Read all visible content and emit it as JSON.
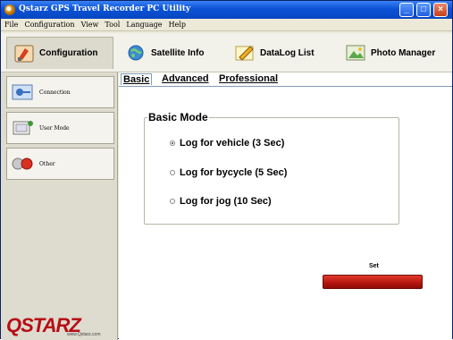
{
  "window": {
    "title": "Qstarz GPS Travel Recorder PC Utility",
    "minimize_glyph": "_",
    "maximize_glyph": "□",
    "close_glyph": "×"
  },
  "menu": [
    "File",
    "Configuration",
    "View",
    "Tool",
    "Language",
    "Help"
  ],
  "top_tabs": [
    {
      "label": "Configuration",
      "icon": "configuration-icon",
      "active": true
    },
    {
      "label": "Satellite Info",
      "icon": "satellite-globe-icon",
      "active": false
    },
    {
      "label": "DataLog List",
      "icon": "datalog-pencil-icon",
      "active": false
    },
    {
      "label": "Photo Manager",
      "icon": "photo-manager-icon",
      "active": false
    }
  ],
  "sidebar": {
    "items": [
      {
        "label": "Connection",
        "icon": "connection-icon"
      },
      {
        "label": "User Mode",
        "icon": "user-mode-icon"
      },
      {
        "label": "Other",
        "icon": "other-icon"
      }
    ],
    "logo_text": "QSTARZ",
    "logo_url": "www.Qstarz.com"
  },
  "sub_tabs": [
    {
      "label": "Basic",
      "active": true
    },
    {
      "label": "Advanced",
      "active": false
    },
    {
      "label": "Professional",
      "active": false
    }
  ],
  "basic_mode": {
    "legend": "Basic Mode",
    "options": [
      {
        "label": "Log for vehicle (3 Sec)",
        "selected": true
      },
      {
        "label": "Log for bycycle (5 Sec)",
        "selected": false
      },
      {
        "label": "Log for jog (10 Sec)",
        "selected": false
      }
    ]
  },
  "set": {
    "label": "Set",
    "button_color": "#c0180f"
  },
  "colors": {
    "titlebar": "#0a52d6",
    "brand_red": "#b70d16"
  }
}
